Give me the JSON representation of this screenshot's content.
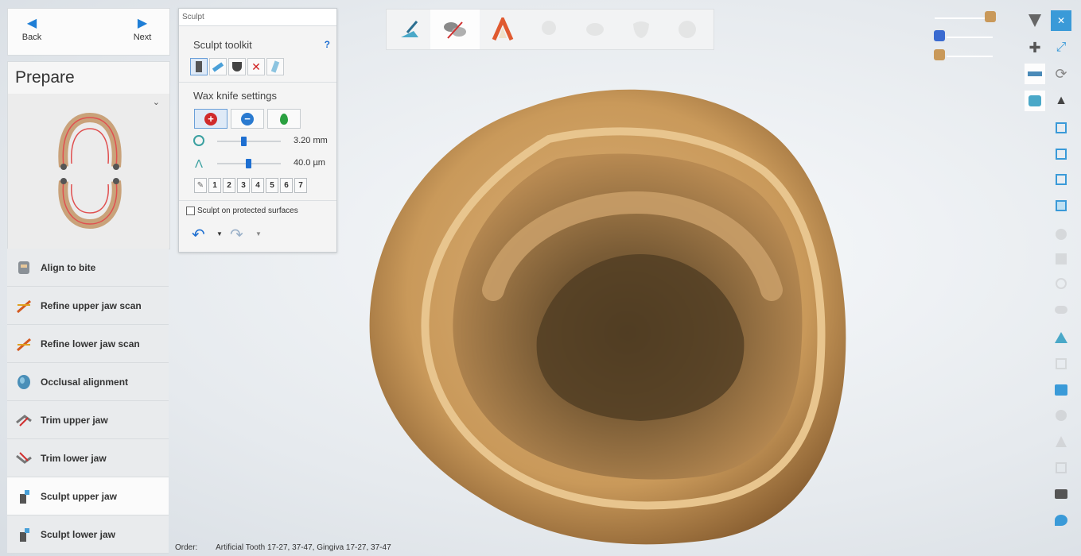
{
  "nav": {
    "back_label": "Back",
    "next_label": "Next"
  },
  "prepare": {
    "title": "Prepare"
  },
  "steps": [
    {
      "label": "Align to bite",
      "icon": "align-bite-icon"
    },
    {
      "label": "Refine upper jaw scan",
      "icon": "refine-upper-icon"
    },
    {
      "label": "Refine lower jaw scan",
      "icon": "refine-lower-icon"
    },
    {
      "label": "Occlusal alignment",
      "icon": "occlusal-icon"
    },
    {
      "label": "Trim upper jaw",
      "icon": "trim-upper-icon"
    },
    {
      "label": "Trim lower jaw",
      "icon": "trim-lower-icon"
    },
    {
      "label": "Sculpt upper jaw",
      "icon": "sculpt-upper-icon",
      "active": true
    },
    {
      "label": "Sculpt lower jaw",
      "icon": "sculpt-lower-icon"
    }
  ],
  "sculpt": {
    "window_title": "Sculpt",
    "toolkit_title": "Sculpt toolkit",
    "help_label": "?",
    "wax_title": "Wax knife settings",
    "size_value": "3.20 mm",
    "depth_value": "40.0 µm",
    "presets": [
      "1",
      "2",
      "3",
      "4",
      "5",
      "6",
      "7"
    ],
    "protected_label": "Sculpt on protected surfaces",
    "protected_checked": false
  },
  "order": {
    "label": "Order:",
    "value": "Artificial Tooth 17-27, 37-47, Gingiva 17-27, 37-47"
  },
  "colors": {
    "accent": "#1e7ed6",
    "model": "#c9995a"
  }
}
